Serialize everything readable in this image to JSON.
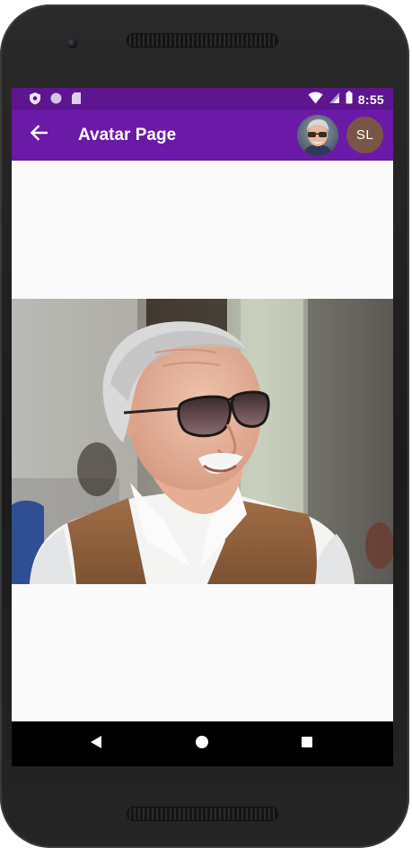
{
  "status_bar": {
    "time": "8:55",
    "icons": [
      "shield-icon",
      "circle-status-icon",
      "sim-card-icon",
      "wifi-icon",
      "cellular-signal-icon",
      "battery-icon"
    ]
  },
  "app_bar": {
    "title": "Avatar Page",
    "back_icon": "arrow-back-icon",
    "avatar_initials": "SL",
    "colors": {
      "app_bar": "#6a1aa6",
      "status_bar": "#5e1590",
      "initials_avatar": "#795548"
    }
  },
  "nav_bar": {
    "buttons": [
      "back-triangle-icon",
      "home-circle-icon",
      "recents-square-icon"
    ]
  }
}
